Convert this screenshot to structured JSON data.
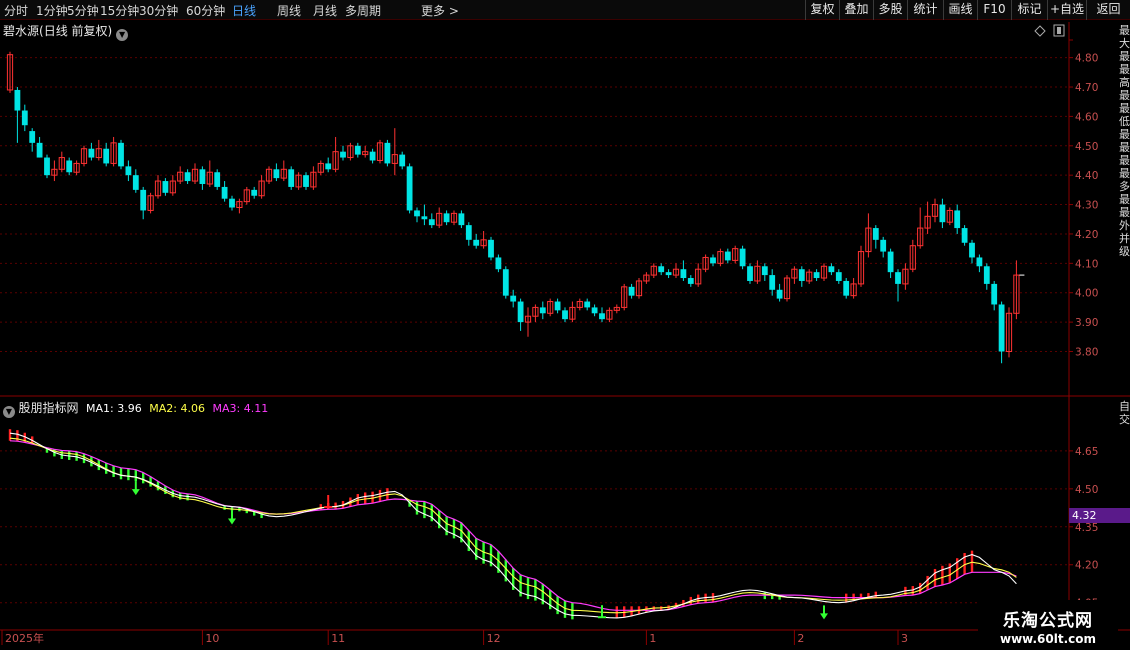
{
  "toolbar": {
    "periods": [
      "分时",
      "1分钟",
      "5分钟",
      "15分钟",
      "30分钟",
      "60分钟",
      "日线",
      "周线",
      "月线",
      "多周期",
      "更多 >"
    ],
    "active_period": "日线",
    "right_buttons": [
      "复权",
      "叠加",
      "多股",
      "统计",
      "画线",
      "F10",
      "标记",
      "+自选",
      "返回"
    ]
  },
  "stock": {
    "name": "碧水源",
    "mode": "(日线 前复权)"
  },
  "colors": {
    "up": "#ff3232",
    "down": "#00e4e4",
    "grid": "#5a0000",
    "axis_text": "#c85050",
    "ma1": "#ffffff",
    "ma2": "#ffff4a",
    "ma3": "#ff3cff",
    "hatch_green": "#33ff33",
    "hatch_red": "#ff2222",
    "price_tag": "#5a1a8a"
  },
  "indicator": {
    "name": "股朋指标网",
    "ma1_label": "MA1:",
    "ma1_value": "3.96",
    "ma2_label": "MA2:",
    "ma2_value": "4.06",
    "ma3_label": "MA3:",
    "ma3_value": "4.11",
    "price_tag": "4.32"
  },
  "x_axis": {
    "labels": [
      "2025年",
      "10",
      "11",
      "12",
      "1",
      "2",
      "3"
    ]
  },
  "right_sidebar_text": {
    "top": "最大最最高最最低最最最最多最最外并级",
    "bottom": "自交"
  },
  "watermark": {
    "title": "乐淘公式网",
    "url": "www.60lt.com"
  },
  "chart_data": [
    {
      "type": "candlestick",
      "title": "碧水源(日线 前复权)",
      "ylim": [
        3.72,
        4.86
      ],
      "yticks": [
        3.8,
        3.9,
        4.0,
        4.1,
        4.2,
        4.3,
        4.4,
        4.5,
        4.6,
        4.7,
        4.8
      ],
      "grid": true,
      "candles": [
        [
          4.69,
          4.81,
          4.82,
          4.68
        ],
        [
          4.69,
          4.62,
          4.7,
          4.51
        ],
        [
          4.62,
          4.57,
          4.64,
          4.55
        ],
        [
          4.55,
          4.51,
          4.56,
          4.48
        ],
        [
          4.51,
          4.46,
          4.53,
          4.46
        ],
        [
          4.46,
          4.4,
          4.47,
          4.39
        ],
        [
          4.4,
          4.42,
          4.45,
          4.38
        ],
        [
          4.42,
          4.46,
          4.48,
          4.41
        ],
        [
          4.45,
          4.41,
          4.46,
          4.4
        ],
        [
          4.41,
          4.44,
          4.45,
          4.4
        ],
        [
          4.44,
          4.49,
          4.5,
          4.43
        ],
        [
          4.49,
          4.46,
          4.51,
          4.45
        ],
        [
          4.46,
          4.49,
          4.52,
          4.45
        ],
        [
          4.49,
          4.44,
          4.51,
          4.43
        ],
        [
          4.44,
          4.51,
          4.53,
          4.43
        ],
        [
          4.51,
          4.43,
          4.52,
          4.42
        ],
        [
          4.43,
          4.4,
          4.45,
          4.38
        ],
        [
          4.4,
          4.35,
          4.42,
          4.34
        ],
        [
          4.35,
          4.28,
          4.36,
          4.25
        ],
        [
          4.28,
          4.33,
          4.34,
          4.27
        ],
        [
          4.33,
          4.38,
          4.4,
          4.32
        ],
        [
          4.38,
          4.34,
          4.39,
          4.33
        ],
        [
          4.34,
          4.38,
          4.4,
          4.33
        ],
        [
          4.38,
          4.41,
          4.43,
          4.37
        ],
        [
          4.41,
          4.38,
          4.42,
          4.37
        ],
        [
          4.38,
          4.42,
          4.44,
          4.37
        ],
        [
          4.42,
          4.37,
          4.43,
          4.35
        ],
        [
          4.37,
          4.41,
          4.45,
          4.36
        ],
        [
          4.41,
          4.36,
          4.42,
          4.35
        ],
        [
          4.36,
          4.32,
          4.38,
          4.31
        ],
        [
          4.32,
          4.29,
          4.33,
          4.28
        ],
        [
          4.29,
          4.31,
          4.32,
          4.27
        ],
        [
          4.31,
          4.35,
          4.36,
          4.3
        ],
        [
          4.35,
          4.33,
          4.36,
          4.32
        ],
        [
          4.33,
          4.38,
          4.4,
          4.32
        ],
        [
          4.38,
          4.42,
          4.43,
          4.37
        ],
        [
          4.42,
          4.39,
          4.44,
          4.38
        ],
        [
          4.39,
          4.42,
          4.45,
          4.38
        ],
        [
          4.42,
          4.36,
          4.43,
          4.35
        ],
        [
          4.36,
          4.4,
          4.41,
          4.35
        ],
        [
          4.4,
          4.36,
          4.41,
          4.35
        ],
        [
          4.36,
          4.41,
          4.43,
          4.35
        ],
        [
          4.41,
          4.44,
          4.45,
          4.4
        ],
        [
          4.44,
          4.42,
          4.46,
          4.41
        ],
        [
          4.42,
          4.48,
          4.53,
          4.41
        ],
        [
          4.48,
          4.46,
          4.5,
          4.45
        ],
        [
          4.46,
          4.5,
          4.51,
          4.45
        ],
        [
          4.5,
          4.47,
          4.51,
          4.46
        ],
        [
          4.47,
          4.48,
          4.5,
          4.46
        ],
        [
          4.48,
          4.45,
          4.49,
          4.44
        ],
        [
          4.45,
          4.51,
          4.52,
          4.44
        ],
        [
          4.51,
          4.44,
          4.52,
          4.43
        ],
        [
          4.44,
          4.47,
          4.56,
          4.4
        ],
        [
          4.47,
          4.43,
          4.48,
          4.42
        ],
        [
          4.43,
          4.28,
          4.44,
          4.27
        ],
        [
          4.28,
          4.26,
          4.29,
          4.24
        ],
        [
          4.26,
          4.25,
          4.3,
          4.23
        ],
        [
          4.25,
          4.23,
          4.27,
          4.22
        ],
        [
          4.23,
          4.27,
          4.29,
          4.22
        ],
        [
          4.27,
          4.24,
          4.28,
          4.23
        ],
        [
          4.24,
          4.27,
          4.28,
          4.23
        ],
        [
          4.27,
          4.23,
          4.28,
          4.22
        ],
        [
          4.23,
          4.18,
          4.24,
          4.16
        ],
        [
          4.18,
          4.16,
          4.2,
          4.15
        ],
        [
          4.16,
          4.18,
          4.21,
          4.15
        ],
        [
          4.18,
          4.12,
          4.19,
          4.11
        ],
        [
          4.12,
          4.08,
          4.13,
          4.07
        ],
        [
          4.08,
          3.99,
          4.09,
          3.98
        ],
        [
          3.99,
          3.97,
          4.01,
          3.95
        ],
        [
          3.97,
          3.9,
          3.98,
          3.87
        ],
        [
          3.9,
          3.92,
          3.95,
          3.85
        ],
        [
          3.92,
          3.95,
          3.96,
          3.9
        ],
        [
          3.95,
          3.93,
          3.97,
          3.91
        ],
        [
          3.93,
          3.97,
          3.98,
          3.92
        ],
        [
          3.97,
          3.94,
          3.98,
          3.93
        ],
        [
          3.94,
          3.91,
          3.95,
          3.9
        ],
        [
          3.91,
          3.95,
          3.97,
          3.9
        ],
        [
          3.95,
          3.97,
          3.98,
          3.94
        ],
        [
          3.97,
          3.95,
          3.98,
          3.94
        ],
        [
          3.95,
          3.93,
          3.96,
          3.92
        ],
        [
          3.93,
          3.91,
          3.95,
          3.9
        ],
        [
          3.91,
          3.94,
          3.95,
          3.9
        ],
        [
          3.94,
          3.95,
          3.96,
          3.93
        ],
        [
          3.95,
          4.02,
          4.03,
          3.94
        ],
        [
          4.02,
          3.99,
          4.03,
          3.98
        ],
        [
          3.99,
          4.04,
          4.05,
          3.98
        ],
        [
          4.04,
          4.06,
          4.07,
          4.03
        ],
        [
          4.06,
          4.09,
          4.1,
          4.05
        ],
        [
          4.09,
          4.07,
          4.1,
          4.06
        ],
        [
          4.07,
          4.06,
          4.08,
          4.05
        ],
        [
          4.06,
          4.08,
          4.1,
          4.05
        ],
        [
          4.08,
          4.05,
          4.11,
          4.04
        ],
        [
          4.05,
          4.03,
          4.06,
          4.02
        ],
        [
          4.03,
          4.08,
          4.1,
          4.02
        ],
        [
          4.08,
          4.12,
          4.13,
          4.07
        ],
        [
          4.12,
          4.1,
          4.13,
          4.09
        ],
        [
          4.1,
          4.14,
          4.15,
          4.09
        ],
        [
          4.14,
          4.11,
          4.15,
          4.1
        ],
        [
          4.11,
          4.15,
          4.16,
          4.1
        ],
        [
          4.15,
          4.09,
          4.16,
          4.08
        ],
        [
          4.09,
          4.04,
          4.1,
          4.03
        ],
        [
          4.04,
          4.09,
          4.11,
          4.03
        ],
        [
          4.09,
          4.06,
          4.1,
          4.04
        ],
        [
          4.06,
          4.01,
          4.08,
          3.99
        ],
        [
          4.01,
          3.98,
          4.03,
          3.97
        ],
        [
          3.98,
          4.05,
          4.06,
          3.97
        ],
        [
          4.05,
          4.08,
          4.09,
          4.03
        ],
        [
          4.08,
          4.04,
          4.09,
          4.02
        ],
        [
          4.04,
          4.07,
          4.08,
          4.03
        ],
        [
          4.07,
          4.05,
          4.08,
          4.04
        ],
        [
          4.05,
          4.09,
          4.1,
          4.04
        ],
        [
          4.09,
          4.07,
          4.1,
          4.06
        ],
        [
          4.07,
          4.04,
          4.08,
          4.03
        ],
        [
          4.04,
          3.99,
          4.05,
          3.98
        ],
        [
          3.99,
          4.03,
          4.05,
          3.98
        ],
        [
          4.03,
          4.14,
          4.16,
          4.02
        ],
        [
          4.14,
          4.22,
          4.27,
          4.12
        ],
        [
          4.22,
          4.18,
          4.23,
          4.15
        ],
        [
          4.18,
          4.14,
          4.19,
          4.12
        ],
        [
          4.14,
          4.07,
          4.15,
          4.05
        ],
        [
          4.07,
          4.03,
          4.08,
          3.97
        ],
        [
          4.03,
          4.08,
          4.1,
          4.01
        ],
        [
          4.08,
          4.16,
          4.18,
          4.07
        ],
        [
          4.16,
          4.22,
          4.29,
          4.15
        ],
        [
          4.22,
          4.26,
          4.31,
          4.2
        ],
        [
          4.26,
          4.3,
          4.32,
          4.24
        ],
        [
          4.3,
          4.24,
          4.32,
          4.22
        ],
        [
          4.24,
          4.28,
          4.29,
          4.23
        ],
        [
          4.28,
          4.22,
          4.3,
          4.2
        ],
        [
          4.22,
          4.17,
          4.23,
          4.16
        ],
        [
          4.17,
          4.12,
          4.18,
          4.1
        ],
        [
          4.12,
          4.09,
          4.13,
          4.07
        ],
        [
          4.09,
          4.03,
          4.1,
          4.01
        ],
        [
          4.03,
          3.96,
          4.04,
          3.94
        ],
        [
          3.96,
          3.8,
          3.97,
          3.76
        ],
        [
          3.8,
          3.93,
          3.95,
          3.78
        ],
        [
          3.93,
          4.06,
          4.11,
          3.91
        ]
      ]
    },
    {
      "type": "line",
      "title": "股朋指标网",
      "ylim": [
        3.95,
        4.78
      ],
      "yticks": [
        4.05,
        4.2,
        4.35,
        4.5,
        4.65
      ],
      "grid": true,
      "ma1_knots": [
        [
          0,
          4.72
        ],
        [
          8,
          4.63
        ],
        [
          16,
          4.55
        ],
        [
          24,
          4.47
        ],
        [
          30,
          4.43
        ],
        [
          36,
          4.39
        ],
        [
          44,
          4.43
        ],
        [
          48,
          4.47
        ],
        [
          52,
          4.49
        ],
        [
          56,
          4.4
        ],
        [
          60,
          4.32
        ],
        [
          64,
          4.22
        ],
        [
          70,
          4.08
        ],
        [
          76,
          4.0
        ],
        [
          82,
          3.99
        ],
        [
          88,
          4.02
        ],
        [
          94,
          4.07
        ],
        [
          100,
          4.1
        ],
        [
          106,
          4.07
        ],
        [
          112,
          4.05
        ],
        [
          118,
          4.08
        ],
        [
          122,
          4.1
        ],
        [
          126,
          4.18
        ],
        [
          130,
          4.24
        ],
        [
          134,
          4.17
        ],
        [
          138,
          4.08
        ],
        [
          141,
          4.0
        ]
      ],
      "ma2_knots": [
        [
          0,
          4.7
        ],
        [
          8,
          4.64
        ],
        [
          16,
          4.55
        ],
        [
          24,
          4.46
        ],
        [
          30,
          4.42
        ],
        [
          36,
          4.4
        ],
        [
          44,
          4.43
        ],
        [
          48,
          4.46
        ],
        [
          52,
          4.48
        ],
        [
          56,
          4.43
        ],
        [
          60,
          4.35
        ],
        [
          64,
          4.25
        ],
        [
          70,
          4.12
        ],
        [
          76,
          4.02
        ],
        [
          82,
          4.01
        ],
        [
          88,
          4.03
        ],
        [
          94,
          4.06
        ],
        [
          100,
          4.09
        ],
        [
          106,
          4.07
        ],
        [
          112,
          4.06
        ],
        [
          118,
          4.07
        ],
        [
          122,
          4.09
        ],
        [
          126,
          4.15
        ],
        [
          130,
          4.21
        ],
        [
          134,
          4.18
        ],
        [
          138,
          4.12
        ],
        [
          141,
          4.06
        ]
      ],
      "ma3_knots": [
        [
          0,
          4.69
        ],
        [
          8,
          4.65
        ],
        [
          16,
          4.58
        ],
        [
          24,
          4.48
        ],
        [
          30,
          4.43
        ],
        [
          36,
          4.4
        ],
        [
          44,
          4.42
        ],
        [
          48,
          4.44
        ],
        [
          52,
          4.46
        ],
        [
          56,
          4.45
        ],
        [
          60,
          4.38
        ],
        [
          64,
          4.29
        ],
        [
          70,
          4.15
        ],
        [
          76,
          4.05
        ],
        [
          82,
          4.02
        ],
        [
          88,
          4.02
        ],
        [
          94,
          4.05
        ],
        [
          100,
          4.08
        ],
        [
          106,
          4.08
        ],
        [
          112,
          4.07
        ],
        [
          118,
          4.07
        ],
        [
          122,
          4.08
        ],
        [
          126,
          4.12
        ],
        [
          130,
          4.17
        ],
        [
          134,
          4.17
        ],
        [
          138,
          4.14
        ],
        [
          141,
          4.11
        ]
      ],
      "hatch_bands": [
        {
          "from": 0,
          "to": 3,
          "color": "red"
        },
        {
          "from": 5,
          "to": 16,
          "color": "green"
        },
        {
          "from": 17,
          "to": 24,
          "color": "green"
        },
        {
          "from": 29,
          "to": 34,
          "color": "green"
        },
        {
          "from": 42,
          "to": 51,
          "color": "red"
        },
        {
          "from": 54,
          "to": 76,
          "color": "green"
        },
        {
          "from": 82,
          "to": 95,
          "color": "red"
        },
        {
          "from": 102,
          "to": 104,
          "color": "green"
        },
        {
          "from": 113,
          "to": 117,
          "color": "red"
        },
        {
          "from": 121,
          "to": 130,
          "color": "red"
        },
        {
          "from": 137,
          "to": 141,
          "color": "green"
        }
      ],
      "arrows": [
        {
          "x": 17,
          "dir": "down",
          "color": "green"
        },
        {
          "x": 30,
          "dir": "down",
          "color": "green"
        },
        {
          "x": 43,
          "dir": "up",
          "color": "red"
        },
        {
          "x": 80,
          "dir": "up",
          "color": "green"
        },
        {
          "x": 110,
          "dir": "down",
          "color": "green"
        }
      ]
    }
  ]
}
